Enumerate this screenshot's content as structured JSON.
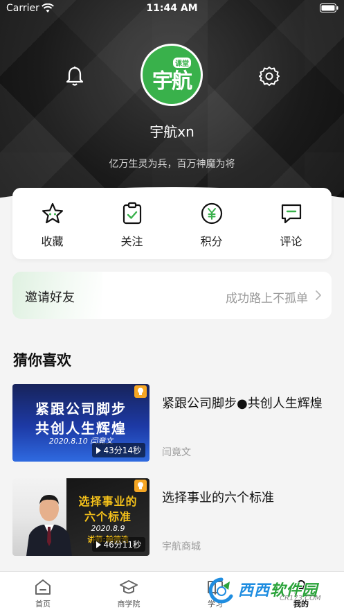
{
  "status_bar": {
    "carrier": "Carrier",
    "time": "11:44 AM"
  },
  "profile": {
    "avatar_main_text": "宇航",
    "avatar_badge_text": "课堂",
    "name": "宇航xn",
    "motto": "亿万生灵为兵，百万神魔为将"
  },
  "quick_actions": [
    {
      "label": "收藏",
      "icon": "star-icon"
    },
    {
      "label": "关注",
      "icon": "clipboard-check-icon"
    },
    {
      "label": "积分",
      "icon": "yen-coin-icon"
    },
    {
      "label": "评论",
      "icon": "comment-icon"
    }
  ],
  "invite": {
    "title": "邀请好友",
    "slogan": "成功路上不孤单"
  },
  "recommend": {
    "title": "猜你喜欢",
    "items": [
      {
        "title": "紧跟公司脚步●共创人生辉煌",
        "author": "闫竟文",
        "thumb_line_1": "紧跟公司脚步",
        "thumb_line_2": "共创人生辉煌",
        "thumb_date": "2020.8.10  闫竟文",
        "duration": "43分14秒"
      },
      {
        "title": "选择事业的六个标准",
        "author": "宇航商城",
        "thumb_line_1": "选择事业的",
        "thumb_line_2": "六个标准",
        "thumb_date": "2020.8.9",
        "thumb_teacher": "讲师:翰德浩",
        "duration": "46分11秒"
      }
    ]
  },
  "tab_bar": {
    "tabs": [
      {
        "label": "首页",
        "icon": "home-icon"
      },
      {
        "label": "商学院",
        "icon": "graduation-cap-icon"
      },
      {
        "label": "学习",
        "icon": "book-icon"
      },
      {
        "label": "我的",
        "icon": "user-icon",
        "active": true
      }
    ]
  },
  "watermark": {
    "main_blue": "西西",
    "main_green": "软件园",
    "sub": "CR173.COM"
  },
  "colors": {
    "brand_green": "#39b14b",
    "header_dark": "#1a1a1a"
  }
}
